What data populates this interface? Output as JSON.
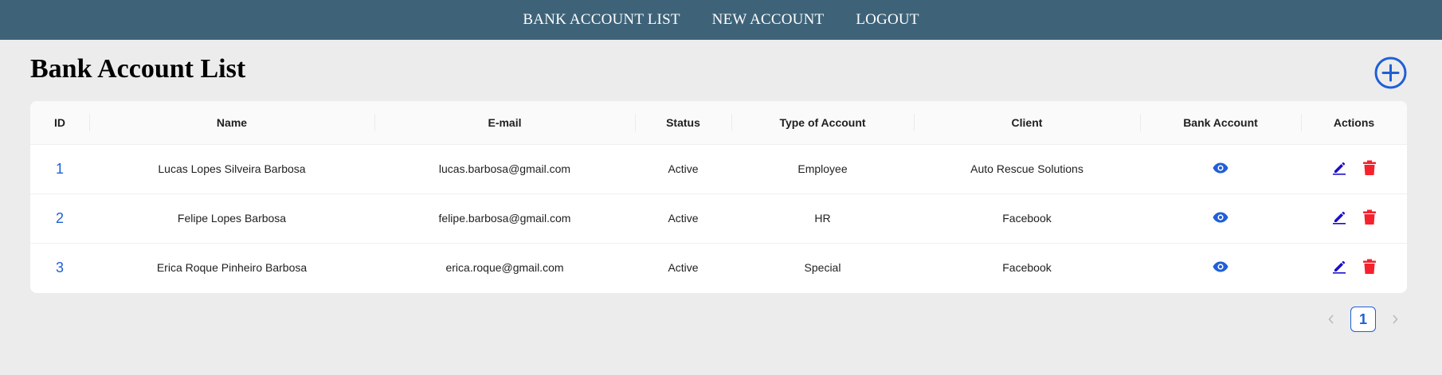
{
  "nav": {
    "items": [
      {
        "label": "BANK ACCOUNT LIST"
      },
      {
        "label": "NEW ACCOUNT"
      },
      {
        "label": "LOGOUT"
      }
    ]
  },
  "page": {
    "title": "Bank Account List"
  },
  "table": {
    "headers": [
      "ID",
      "Name",
      "E-mail",
      "Status",
      "Type of Account",
      "Client",
      "Bank Account",
      "Actions"
    ],
    "rows": [
      {
        "id": "1",
        "name": "Lucas Lopes Silveira Barbosa",
        "email": "lucas.barbosa@gmail.com",
        "status": "Active",
        "type": "Employee",
        "client": "Auto Rescue Solutions"
      },
      {
        "id": "2",
        "name": "Felipe Lopes Barbosa",
        "email": "felipe.barbosa@gmail.com",
        "status": "Active",
        "type": "HR",
        "client": "Facebook"
      },
      {
        "id": "3",
        "name": "Erica Roque Pinheiro Barbosa",
        "email": "erica.roque@gmail.com",
        "status": "Active",
        "type": "Special",
        "client": "Facebook"
      }
    ]
  },
  "pagination": {
    "current_page": "1",
    "prev_icon": "chevron-left-icon",
    "next_icon": "chevron-right-icon"
  },
  "icons": {
    "add": "plus-circle-icon",
    "view": "eye-icon",
    "edit": "pencil-icon",
    "delete": "trash-icon"
  },
  "colors": {
    "navbar": "#3e6379",
    "accent": "#1f5fd6",
    "edit": "#1a0dcc",
    "delete": "#f5222d"
  }
}
